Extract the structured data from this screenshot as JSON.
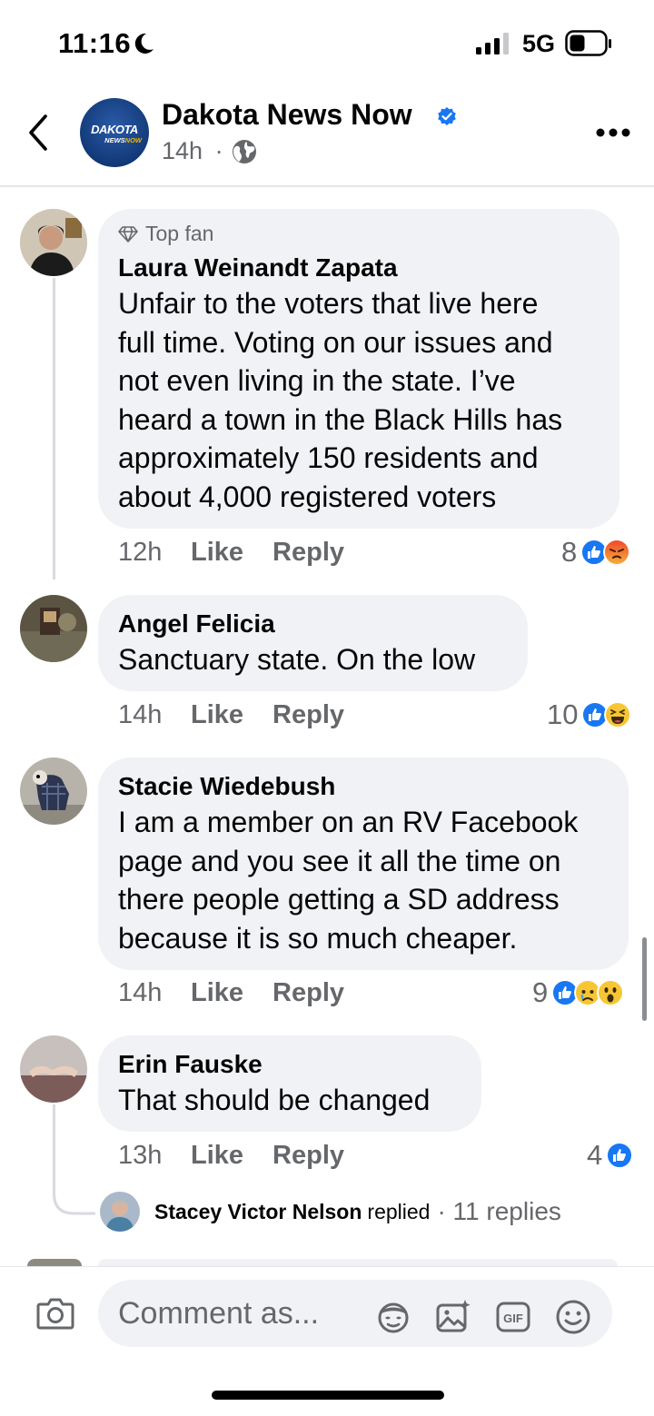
{
  "status_bar": {
    "time": "11:16",
    "network": "5G"
  },
  "header": {
    "page_name": "Dakota News Now",
    "time_ago": "14h",
    "separator": "·",
    "logo_line1": "DAKOTA",
    "logo_line2a": "NEWS",
    "logo_line2b": "NOW"
  },
  "comments": [
    {
      "badge": "Top fan",
      "author": "Laura Weinandt Zapata",
      "lines": [
        "Unfair to the voters that live here",
        "full time. Voting on our issues and",
        "not even living in the state. I’ve",
        "heard a town in the Black Hills has",
        "approximately 150 residents and",
        "about 4,000 registered voters"
      ],
      "time": "12h",
      "like": "Like",
      "reply": "Reply",
      "reactions": "8"
    },
    {
      "author": "Angel Felicia",
      "lines": [
        "Sanctuary state. On the low"
      ],
      "time": "14h",
      "like": "Like",
      "reply": "Reply",
      "reactions": "10"
    },
    {
      "author": "Stacie Wiedebush",
      "lines": [
        "I am a member on an RV Facebook",
        "page and you see it all the time on",
        "there people getting a SD address",
        "because it is so much cheaper."
      ],
      "time": "14h",
      "like": "Like",
      "reply": "Reply",
      "reactions": "9"
    },
    {
      "author": "Erin Fauske",
      "lines": [
        "That should be changed"
      ],
      "time": "13h",
      "like": "Like",
      "reply": "Reply",
      "reactions": "4",
      "replied_by": "Stacey Victor Nelson",
      "replied_word": "replied",
      "reply_count": "· 11 replies"
    }
  ],
  "composer": {
    "placeholder": "Comment as..."
  },
  "colors": {
    "like_blue": "#1877f2",
    "bubble": "#f0f2f5",
    "muted": "#65676b"
  },
  "icons": [
    "back-icon",
    "verified-icon",
    "globe-icon",
    "more-icon",
    "diamond-icon",
    "like-reaction-icon",
    "angry-reaction-icon",
    "haha-reaction-icon",
    "sad-reaction-icon",
    "wow-reaction-icon",
    "camera-icon",
    "avatar-sticker-icon",
    "photo-icon",
    "gif-icon",
    "emoji-icon"
  ]
}
